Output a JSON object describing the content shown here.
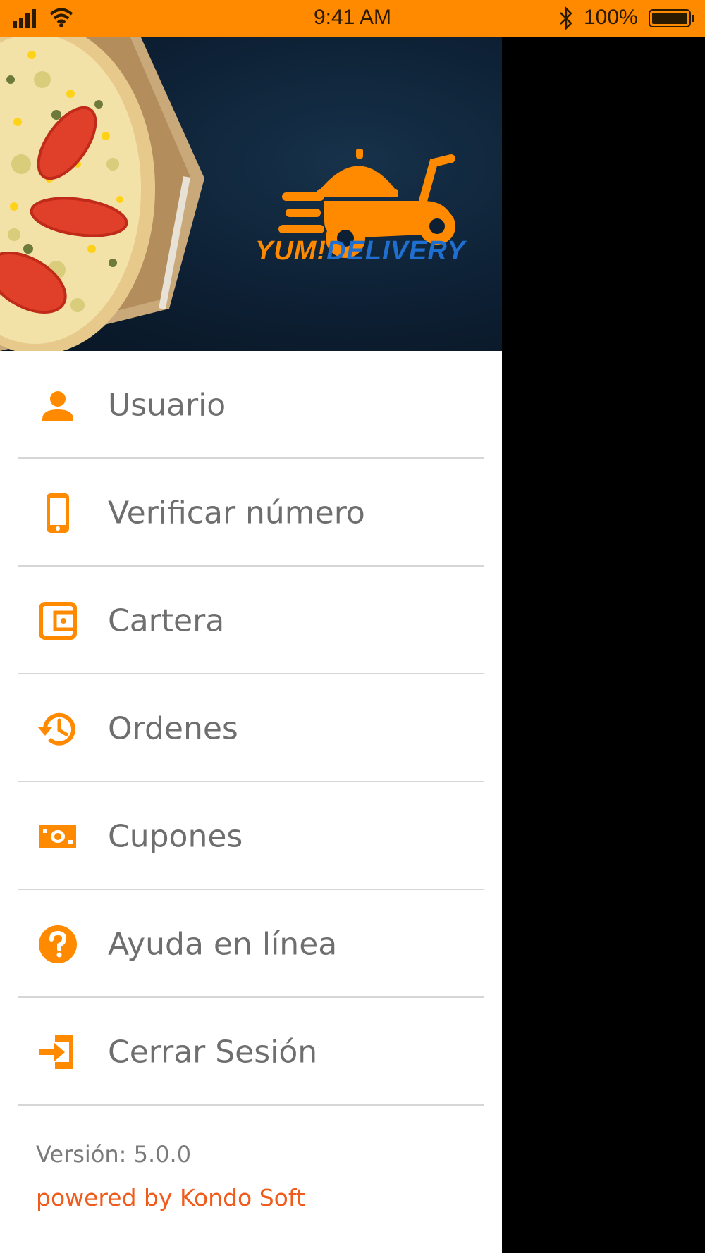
{
  "status_bar": {
    "time": "9:41 AM",
    "battery_percent": "100%",
    "background_color": "#FF8A00"
  },
  "banner": {
    "brand_yum": "YUM!",
    "brand_delivery": "DELIVERY",
    "icon": "scooter-delivery-logo"
  },
  "menu": {
    "items": [
      {
        "label": "Usuario",
        "icon": "person-icon"
      },
      {
        "label": "Verificar número",
        "icon": "smartphone-icon"
      },
      {
        "label": "Cartera",
        "icon": "wallet-icon"
      },
      {
        "label": "Ordenes",
        "icon": "history-icon"
      },
      {
        "label": "Cupones",
        "icon": "money-icon"
      },
      {
        "label": "Ayuda en línea",
        "icon": "help-icon"
      },
      {
        "label": "Cerrar Sesión",
        "icon": "logout-icon"
      }
    ]
  },
  "footer": {
    "version": "Versión: 5.0.0",
    "powered_by": "powered by Kondo Soft"
  },
  "colors": {
    "accent": "#FF8A00",
    "powered_text": "#F05A1A",
    "label_text": "#6e6e6e"
  }
}
